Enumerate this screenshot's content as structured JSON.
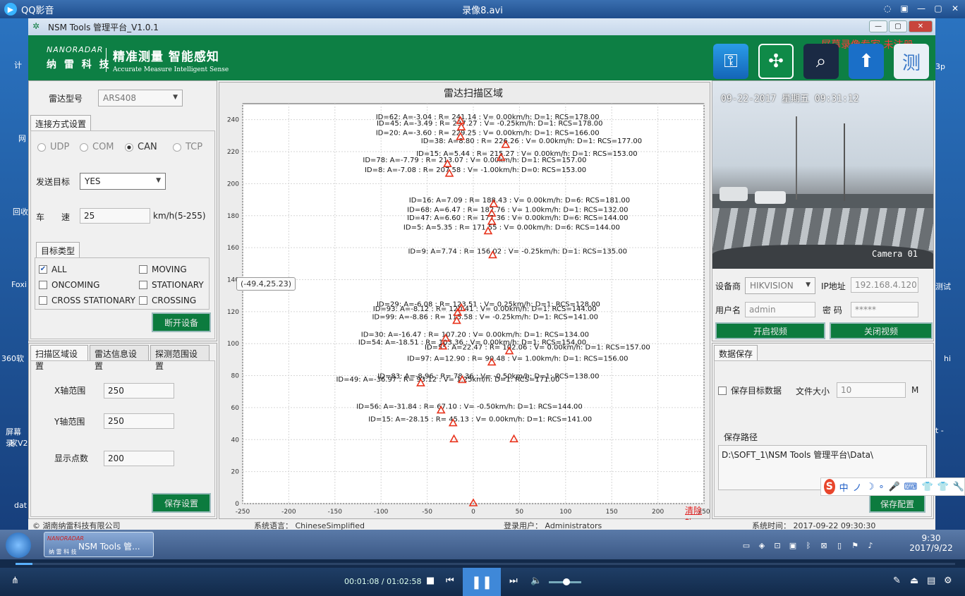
{
  "player": {
    "app_name": "QQ影音",
    "file_title": "录像8.avi",
    "time_display": "00:01:08 / 01:02:58"
  },
  "desktop": {
    "left_labels": [
      "计",
      "网",
      "回收",
      "Foxi",
      "360软",
      "屏幕录",
      "家V2",
      "dat"
    ],
    "right_labels": [
      "3p",
      "测试",
      "hi",
      "t -"
    ]
  },
  "nsm": {
    "title": "NSM Tools 管理平台_V1.0.1",
    "brand_en": "NANORADAR",
    "brand_cn": "纳 雷 科 技",
    "slogan_cn": "精准测量   智能感知",
    "slogan_en": "Accurate Measure   Intelligent Sense",
    "watermark": "屏幕录像专家 未注册",
    "icons": [
      "key-icon",
      "butterfly-icon",
      "search-lens-icon",
      "upload-arrow-icon",
      "monitor-heart-icon"
    ],
    "left": {
      "radar_type_label": "雷达型号",
      "radar_type_value": "ARS408",
      "conn_tab": "连接方式设置",
      "radios": [
        "UDP",
        "COM",
        "CAN",
        "TCP"
      ],
      "send_target_label": "发送目标",
      "send_target_value": "YES",
      "speed_label_1": "车",
      "speed_label_2": "速",
      "speed_value": "25",
      "speed_unit": "km/h(5-255)",
      "target_type_tab": "目标类型",
      "checks": {
        "all": "ALL",
        "moving": "MOVING",
        "oncoming": "ONCOMING",
        "stationary": "STATIONARY",
        "cross_stationary": "CROSS STATIONARY",
        "crossing": "CROSSING"
      },
      "disconnect_btn": "断开设备",
      "tabs2": [
        "扫描区域设置",
        "雷达信息设置",
        "探测范围设置"
      ],
      "x_range_label": "X轴范围",
      "x_range_value": "250",
      "y_range_label": "Y轴范围",
      "y_range_value": "250",
      "points_label": "显示点数",
      "points_value": "200",
      "save_settings_btn": "保存设置"
    },
    "chart": {
      "clear_link": "清除轨",
      "cursor_tooltip": "(-49.4,25.23)"
    },
    "right": {
      "video_timestamp": "09-22-2017 星期五 09:31:12",
      "camera_label": "Camera 01",
      "vendor_label": "设备商",
      "vendor_value": "HIKVISION",
      "ip_label": "IP地址",
      "ip_value": "192.168.4.120",
      "user_label": "用户名",
      "user_value": "admin",
      "pwd_label": "密  码",
      "pwd_value": "*****",
      "open_video_btn": "开启视频",
      "close_video_btn": "关闭视频",
      "data_save_tab": "数据保存",
      "save_target_label": "保存目标数据",
      "file_size_label": "文件大小",
      "file_size_value": "10",
      "file_size_unit": "M",
      "save_path_label": "保存路径",
      "save_path_value": "D:\\SOFT_1\\NSM Tools 管理平台\\Data\\",
      "save_config_btn": "保存配置"
    },
    "status": {
      "company": "© 湖南纳雷科技有限公司",
      "lang": "系统语言：  ChineseSimplified",
      "user": "登录用户：  Administrators",
      "time": "系统时间：  2017-09-22 09:30:30"
    }
  },
  "taskbar": {
    "task_label": "NSM Tools 管...",
    "task_mini": "NANORADAR",
    "task_mini_cn": "纳 雷 科 技",
    "clock_time": "9:30",
    "clock_date": "2017/9/22"
  },
  "ime": {
    "chars": [
      "中",
      "ノ",
      "☽",
      "∘",
      "🎤",
      "⌨",
      "👕",
      "👕",
      "🔧"
    ]
  },
  "chart_data": {
    "type": "scatter",
    "title": "雷达扫描区域",
    "xlim": [
      -250,
      250
    ],
    "ylim": [
      0,
      250
    ],
    "xticks": [
      -250,
      -200,
      -150,
      -100,
      -50,
      0,
      50,
      100,
      150,
      200,
      250
    ],
    "yticks": [
      0,
      20,
      40,
      60,
      80,
      100,
      120,
      140,
      160,
      180,
      200,
      220,
      240
    ],
    "marker": "triangle",
    "marker_color": "#e8331c",
    "points": [
      {
        "x": -14,
        "y": 239,
        "label": "ID=62:  A=-3.04 :  R= 241.14 :  V= 0.00km/h:  D=1:  RCS=178.00"
      },
      {
        "x": -13,
        "y": 235,
        "label": "ID=45:  A=-3.49 :  R= 237.27 :  V= -0.25km/h:  D=1:  RCS=178.00"
      },
      {
        "x": -14,
        "y": 229,
        "label": "ID=20:  A=-3.60 :  R= 229.25 :  V= 0.00km/h:  D=1:  RCS=166.00"
      },
      {
        "x": 35,
        "y": 224,
        "label": "ID=38:  A=8.80 :  R= 226.26 :  V= 0.00km/h:  D=1:  RCS=177.00"
      },
      {
        "x": 30,
        "y": 216,
        "label": "ID=15:  A=5.44 :  R= 215.27 :  V= 0.00km/h:  D=1:  RCS=153.00"
      },
      {
        "x": -28,
        "y": 212,
        "label": "ID=78:  A=-7.79 :  R= 213.07 :  V= 0.00km/h:  D=1:  RCS=157.00"
      },
      {
        "x": -26,
        "y": 206,
        "label": "ID=8:  A=-7.08 :  R= 207.58 :  V= -1.00km/h:  D=0:  RCS=153.00"
      },
      {
        "x": 22,
        "y": 187,
        "label": "ID=16:  A=7.09 :  R= 188.43 :  V= 0.00km/h:  D=6:  RCS=181.00"
      },
      {
        "x": 20,
        "y": 181,
        "label": "ID=68:  A=6.47 :  R= 182.76 :  V= 1.00km/h:  D=1:  RCS=132.00"
      },
      {
        "x": 20,
        "y": 176,
        "label": "ID=47:  A=6.60 :  R= 177.36 :  V= 0.00km/h:  D=6:  RCS=144.00"
      },
      {
        "x": 16,
        "y": 170,
        "label": "ID=5:  A=5.35 :  R= 171.55 :  V= 0.00km/h:  D=6:  RCS=144.00"
      },
      {
        "x": 21,
        "y": 155,
        "label": "ID=9:  A=7.74 :  R= 156.02 :  V= -0.25km/h:  D=1:  RCS=135.00"
      },
      {
        "x": -13,
        "y": 122,
        "label": "ID=29:  A=-6.08 :  R= 123.51 :  V= 0.25km/h:  D=1:  RCS=128.00"
      },
      {
        "x": -17,
        "y": 119,
        "label": "ID=93:  A=-8.12 :  R= 120.41 :  V= 0.00km/h:  D=1:  RCS=144.00"
      },
      {
        "x": -18,
        "y": 114,
        "label": "ID=99:  A=-8.86 :  R= 115.58 :  V= -0.25km/h:  D=1:  RCS=141.00"
      },
      {
        "x": -30,
        "y": 103,
        "label": "ID=30:  A=-16.47 :  R= 107.20 :  V= 0.00km/h:  D=1:  RCS=134.00"
      },
      {
        "x": -33,
        "y": 98,
        "label": "ID=54:  A=-18.51 :  R= 103.36 :  V= 0.00km/h:  D=1:  RCS=154.00"
      },
      {
        "x": 39,
        "y": 95,
        "label": "ID=55:  A=22.47 :  R= 102.06 :  V= 0.00km/h:  D=1:  RCS=157.00"
      },
      {
        "x": 20,
        "y": 88,
        "label": "ID=97:  A=12.90 :  R= 90.48 :  V= 1.00km/h:  D=1:  RCS=156.00"
      },
      {
        "x": -12,
        "y": 77,
        "label": "ID=83:  A=-8.96 :  R= 78.36 :  V= -0.50km/h:  D=1:  RCS=138.00"
      },
      {
        "x": -57,
        "y": 75,
        "label": "ID=49:  A=-36.97 :  R= 93.12 :  V= 1.25km/h:  D=1:  RCS=171.00"
      },
      {
        "x": -35,
        "y": 58,
        "label": "ID=56:  A=-31.84 :  R= 67.10 :  V= -0.50km/h:  D=1:  RCS=144.00"
      },
      {
        "x": -22,
        "y": 50,
        "label": "ID=15:  A=-28.15 :  R= 45.13 :  V= 0.00km/h:  D=1:  RCS=141.00"
      },
      {
        "x": 44,
        "y": 40,
        "label": ""
      },
      {
        "x": -21,
        "y": 40,
        "label": ""
      },
      {
        "x": 0,
        "y": 0,
        "label": ""
      }
    ]
  }
}
